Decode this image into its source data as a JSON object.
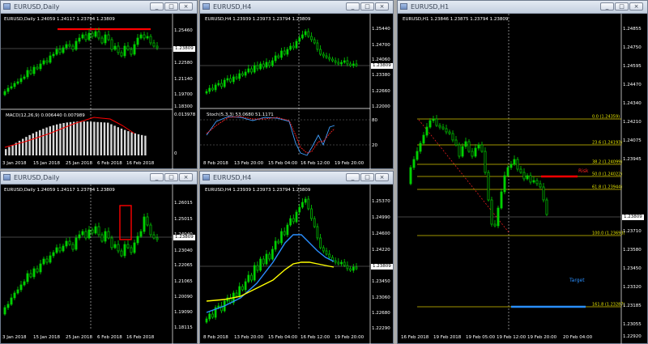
{
  "windows": [
    {
      "id": "w1",
      "title": "EURUSD,Daily",
      "header": "EURUSD,Daily  1.24059 1.24117 1.23794 1.23809",
      "price_labels": [
        "1.25460",
        "1.23809",
        "1.22580",
        "1.21140",
        "1.19700",
        "1.18300"
      ],
      "current_price": "1.23809",
      "indicator_header": "MACD(12,26,9) 0.006440 0.007989",
      "indicator_labels": [
        "0.013978",
        "0"
      ],
      "time_labels": [
        "3 Jan 2018",
        "15 Jan 2018",
        "25 Jan 2018",
        "6 Feb 2018",
        "16 Feb 2018"
      ]
    },
    {
      "id": "w2",
      "title": "EURUSD,H4",
      "header": "EURUSD,H4  1.23939 1.23973 1.23794 1.23809",
      "price_labels": [
        "1.25440",
        "1.24700",
        "1.24060",
        "1.23809",
        "1.23380",
        "1.22660",
        "1.22000"
      ],
      "current_price": "1.23809",
      "indicator_header": "Stoch(5,3,3) 53.0680 51.1171",
      "indicator_labels": [
        "80",
        "20"
      ],
      "time_labels": [
        "8 Feb 2018",
        "13 Feb 20:00",
        "15 Feb 04:00",
        "16 Feb 12:00",
        "19 Feb 20:00"
      ]
    },
    {
      "id": "w3",
      "title": "EURUSD,Daily",
      "header": "EURUSD,Daily  1.24059 1.24117 1.23794 1.23809",
      "price_labels": [
        "1.26015",
        "1.25015",
        "1.24040",
        "1.23809",
        "1.23040",
        "1.22065",
        "1.21065",
        "1.20090",
        "1.19090",
        "1.18115"
      ],
      "current_price": "1.23809",
      "time_labels": [
        "3 Jan 2018",
        "15 Jan 2018",
        "25 Jan 2018",
        "6 Feb 2018",
        "16 Feb 2018"
      ]
    },
    {
      "id": "w4",
      "title": "EURUSD,H4",
      "header": "EURUSD,H4  1.23939 1.23973 1.23794 1.23809",
      "price_labels": [
        "1.25370",
        "1.24990",
        "1.24600",
        "1.24220",
        "1.23809",
        "1.23450",
        "1.23060",
        "1.22680",
        "1.22290"
      ],
      "current_price": "1.23809",
      "time_labels": [
        "8 Feb 2018",
        "13 Feb 20:00",
        "15 Feb 04:00",
        "16 Feb 12:00",
        "19 Feb 20:00"
      ]
    },
    {
      "id": "w5",
      "title": "EURUSD,H1",
      "header": "EURUSD,H1  1.23846 1.23875 1.23794 1.23809",
      "price_labels": [
        "1.24855",
        "1.24750",
        "1.24595",
        "1.24470",
        "1.24340",
        "1.24210",
        "1.24075",
        "1.23945",
        "1.23809",
        "1.23710",
        "1.23580",
        "1.23450",
        "1.23320",
        "1.23185",
        "1.23055",
        "1.22920"
      ],
      "current_price": "1.23809",
      "fib_levels": [
        "0.0 (1.24359)",
        "23.6 (1.24193)",
        "38.2 (1.24099)",
        "50.0 (1.24022)",
        "61.8 (1.23944)",
        "100.0 (1.23693)",
        "161.8 (1.23287)"
      ],
      "risk_label": "Risk",
      "target_label": "Target",
      "time_labels": [
        "16 Feb 2018",
        "19 Feb 2018",
        "19 Feb 05:00",
        "19 Feb 12:00",
        "19 Feb 20:00",
        "20 Feb 04:00"
      ]
    }
  ],
  "window_controls": {
    "minimize": "_",
    "maximize": "□",
    "close": "×"
  },
  "colors": {
    "candle": "#00d000",
    "macd_signal": "#ff0000",
    "stoch_main": "#40a0ff",
    "stoch_signal": "#ff2020",
    "ma_blue": "#2a8fff",
    "ma_yellow": "#ffff00",
    "fib": "#d6c400",
    "resistance": "#ff0000",
    "target_bar": "#2a8fff"
  }
}
